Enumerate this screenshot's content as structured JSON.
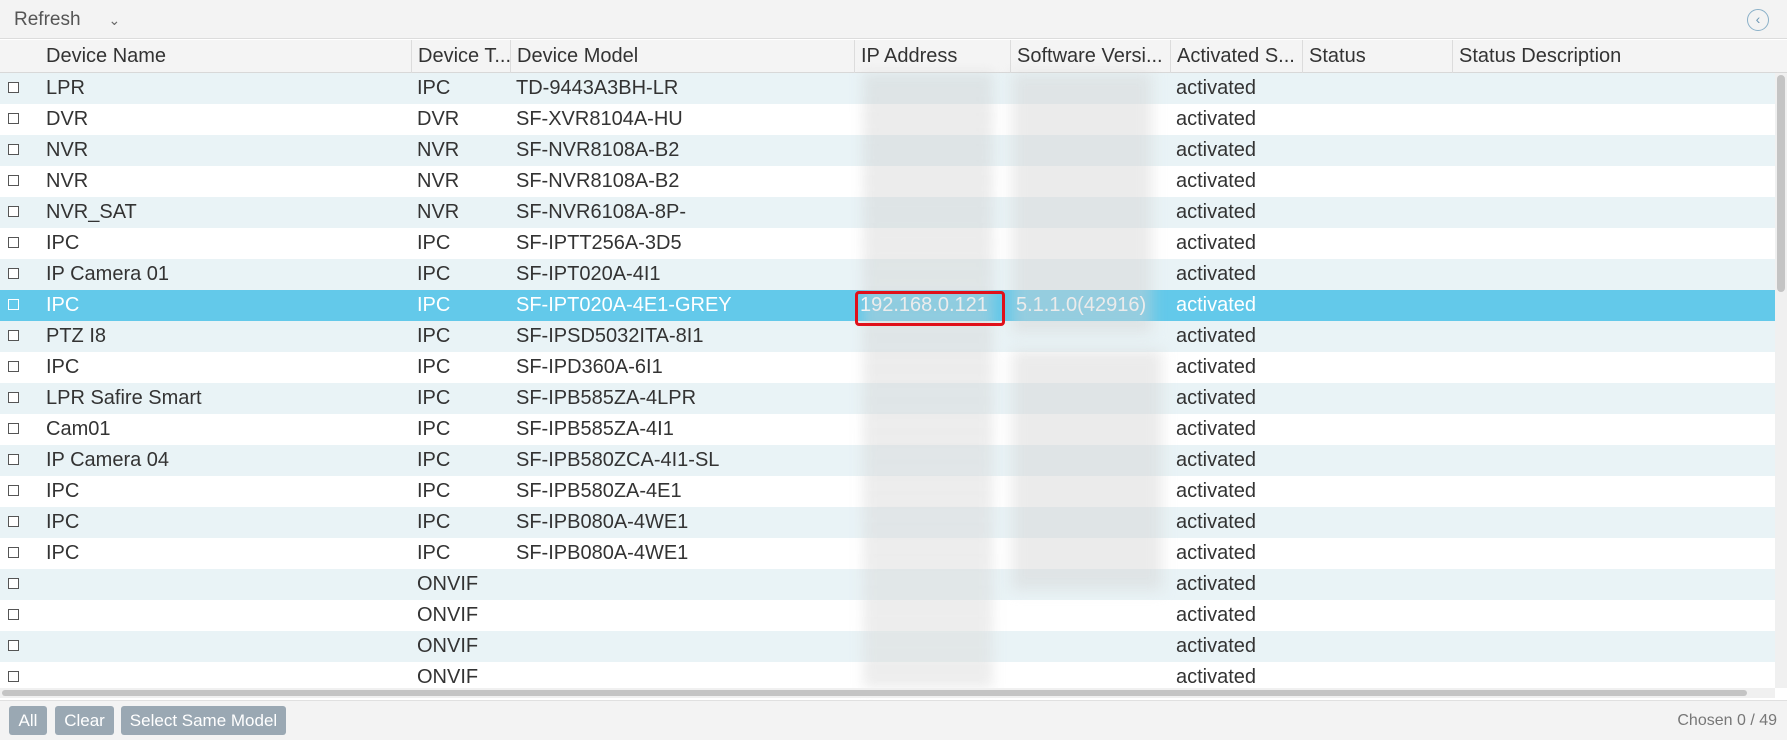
{
  "toolbar": {
    "refresh_label": "Refresh",
    "chevron": "⌄",
    "collapse_icon": "‹"
  },
  "columns": [
    "Device Name",
    "Device T...",
    "Device Model",
    "IP Address",
    "Software Versi...",
    "Activated S...",
    "Status",
    "Status Description"
  ],
  "rows": [
    {
      "name": "LPR",
      "type": "IPC",
      "model": "TD-9443A3BH-LR",
      "ip": "",
      "software": "",
      "activated": "activated",
      "status": "",
      "description": ""
    },
    {
      "name": "DVR",
      "type": "DVR",
      "model": "SF-XVR8104A-HU",
      "ip": "",
      "software": "",
      "activated": "activated",
      "status": "",
      "description": ""
    },
    {
      "name": "NVR",
      "type": "NVR",
      "model": "SF-NVR8108A-B2",
      "ip": "",
      "software": "",
      "activated": "activated",
      "status": "",
      "description": ""
    },
    {
      "name": "NVR",
      "type": "NVR",
      "model": "SF-NVR8108A-B2",
      "ip": "",
      "software": "",
      "activated": "activated",
      "status": "",
      "description": ""
    },
    {
      "name": "NVR_SAT",
      "type": "NVR",
      "model": "SF-NVR6108A-8P-",
      "ip": "",
      "software": "",
      "activated": "activated",
      "status": "",
      "description": ""
    },
    {
      "name": "IPC",
      "type": "IPC",
      "model": "SF-IPTT256A-3D5",
      "ip": "",
      "software": "",
      "activated": "activated",
      "status": "",
      "description": ""
    },
    {
      "name": "IP Camera 01",
      "type": "IPC",
      "model": "SF-IPT020A-4I1",
      "ip": "",
      "software": "",
      "activated": "activated",
      "status": "",
      "description": ""
    },
    {
      "name": "IPC",
      "type": "IPC",
      "model": "SF-IPT020A-4E1-GREY",
      "ip": "192.168.0.121",
      "software": "5.1.1.0(42916)",
      "activated": "activated",
      "status": "",
      "description": ""
    },
    {
      "name": "PTZ I8",
      "type": "IPC",
      "model": "SF-IPSD5032ITA-8I1",
      "ip": "",
      "software": "",
      "activated": "activated",
      "status": "",
      "description": ""
    },
    {
      "name": "IPC",
      "type": "IPC",
      "model": "SF-IPD360A-6I1",
      "ip": "",
      "software": "",
      "activated": "activated",
      "status": "",
      "description": ""
    },
    {
      "name": "LPR Safire Smart",
      "type": "IPC",
      "model": "SF-IPB585ZA-4LPR",
      "ip": "",
      "software": "",
      "activated": "activated",
      "status": "",
      "description": ""
    },
    {
      "name": "Cam01",
      "type": "IPC",
      "model": "SF-IPB585ZA-4I1",
      "ip": "",
      "software": "",
      "activated": "activated",
      "status": "",
      "description": ""
    },
    {
      "name": "IP Camera 04",
      "type": "IPC",
      "model": "SF-IPB580ZCA-4I1-SL",
      "ip": "",
      "software": "",
      "activated": "activated",
      "status": "",
      "description": ""
    },
    {
      "name": "IPC",
      "type": "IPC",
      "model": "SF-IPB580ZA-4E1",
      "ip": "",
      "software": "",
      "activated": "activated",
      "status": "",
      "description": ""
    },
    {
      "name": "IPC",
      "type": "IPC",
      "model": "SF-IPB080A-4WE1",
      "ip": "",
      "software": "",
      "activated": "activated",
      "status": "",
      "description": ""
    },
    {
      "name": "IPC",
      "type": "IPC",
      "model": "SF-IPB080A-4WE1",
      "ip": "",
      "software": "",
      "activated": "activated",
      "status": "",
      "description": ""
    },
    {
      "name": "",
      "type": "ONVIF",
      "model": "",
      "ip": "",
      "software": "",
      "activated": "activated",
      "status": "",
      "description": ""
    },
    {
      "name": "",
      "type": "ONVIF",
      "model": "",
      "ip": "",
      "software": "",
      "activated": "activated",
      "status": "",
      "description": ""
    },
    {
      "name": "",
      "type": "ONVIF",
      "model": "",
      "ip": "",
      "software": "",
      "activated": "activated",
      "status": "",
      "description": ""
    },
    {
      "name": "",
      "type": "ONVIF",
      "model": "",
      "ip": "",
      "software": "",
      "activated": "activated",
      "status": "",
      "description": ""
    }
  ],
  "selected_row_index": 7,
  "footer": {
    "all_label": "All",
    "clear_label": "Clear",
    "same_model_label": "Select Same Model",
    "chosen_text": "Chosen  0 / 49"
  },
  "colors": {
    "selected_row": "#63c9ea",
    "alt_row": "#e9f3f6",
    "highlight": "#e0101a",
    "footer_button": "#9aa8b3"
  }
}
